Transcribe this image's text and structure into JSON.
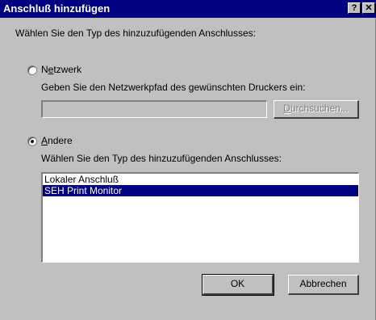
{
  "window": {
    "title": "Anschluß hinzufügen",
    "help_glyph": "?",
    "close_glyph": "✕"
  },
  "dialog": {
    "instruction": "Wählen Sie den Typ des hinzuzufügenden Anschlusses:",
    "network": {
      "label_first": "N",
      "label_ul": "e",
      "label_rest": "tzwerk",
      "selected": false,
      "path_prompt": "Geben Sie den Netzwerkpfad des gewünschten Druckers ein:",
      "path_value": "",
      "browse_ul": "D",
      "browse_rest": "urchsuchen..."
    },
    "other": {
      "label_ul": "A",
      "label_rest": "ndere",
      "selected": true,
      "list_prompt": "Wählen Sie den Typ des hinzuzufügenden Anschlusses:",
      "ports": [
        "Lokaler Anschluß",
        "SEH Print Monitor"
      ],
      "selected_port": "SEH Print Monitor"
    },
    "ok_label": "OK",
    "cancel_label": "Abbrechen"
  }
}
